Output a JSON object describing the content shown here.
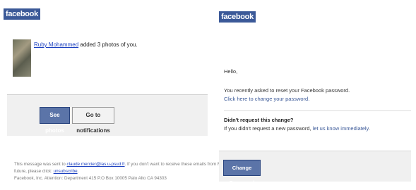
{
  "left_email": {
    "logo": "facebook",
    "notification": {
      "actor": "Ruby Mohammed",
      "text": " added 3 photos of you."
    },
    "buttons": {
      "see_photos": "See photos",
      "go_to_notifications": "Go to notifications"
    },
    "footer": {
      "sent_to_prefix": "This message was sent to ",
      "email": "claude.mercier@ias.u-psud.fr",
      "sent_to_suffix": ". If you don't want to receive these emails from Facebook in the",
      "line2_prefix": "future, please click: ",
      "unsubscribe": "unsubscribe",
      "line2_suffix": ".",
      "address": "Facebook, Inc. Attention: Department 415 P.O Box 10005 Palo Alto CA 94303"
    }
  },
  "right_email": {
    "logo": "facebook",
    "greeting": "Hello,",
    "reset_text": "You recently asked to reset your Facebook password.",
    "change_link": "Click here to change your password.",
    "heading": "Didn't request this change?",
    "didnt_request_text": "If you didn't request a new password, ",
    "let_us_know_link": "let us know immediately",
    "period": ".",
    "change_button": "Change Password"
  }
}
